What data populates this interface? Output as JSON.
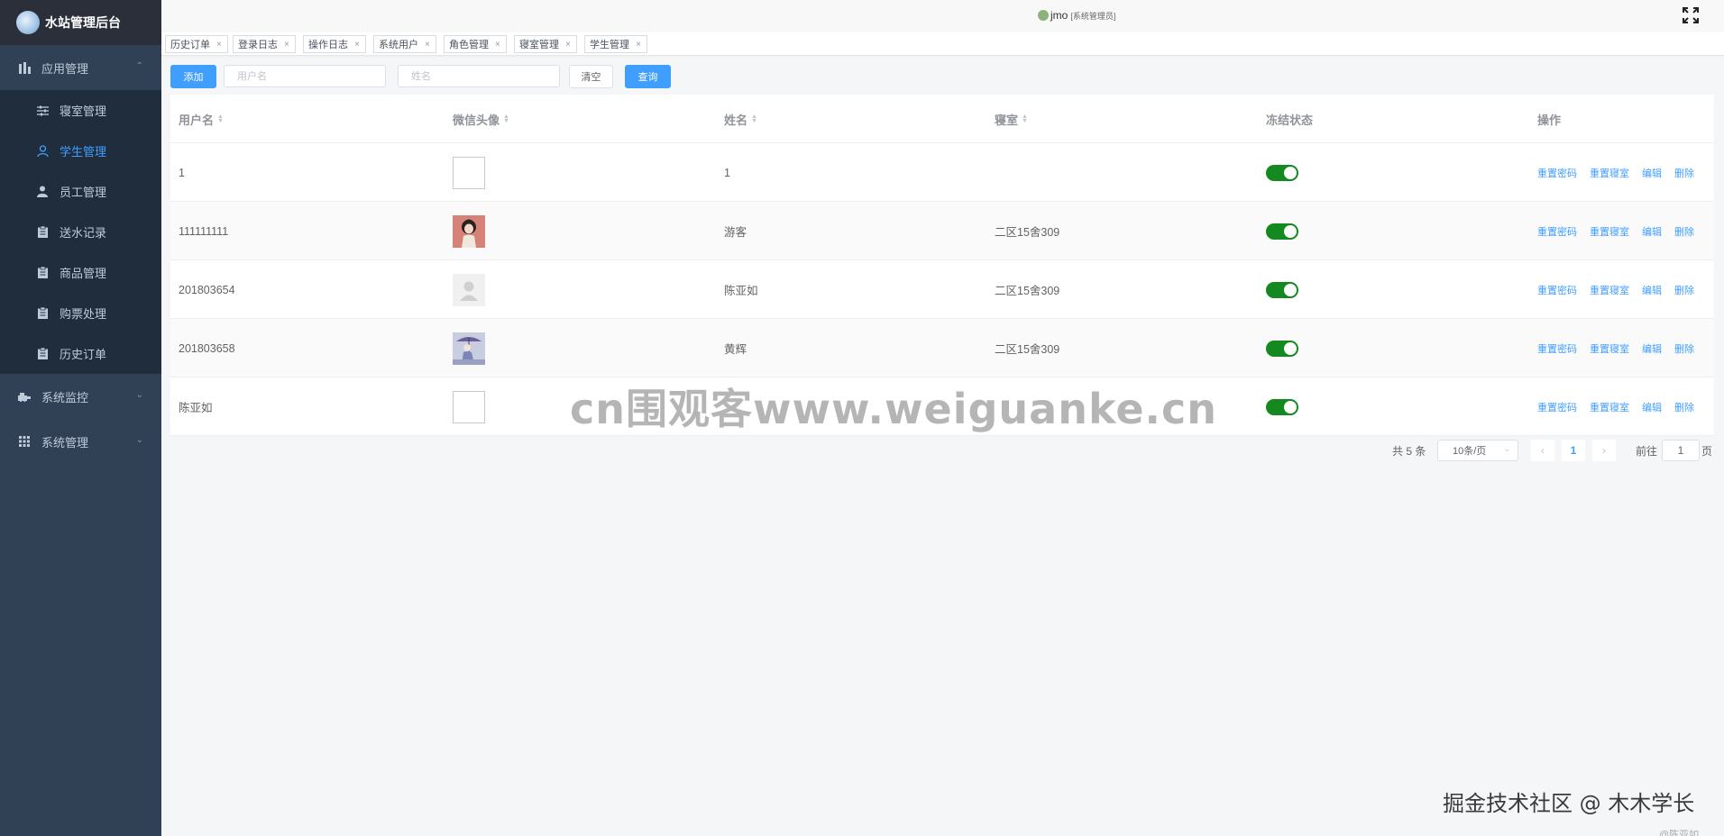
{
  "sidebar": {
    "title": "水站管理后台",
    "groups": [
      {
        "label": "应用管理",
        "expanded": true,
        "icon": "chart-icon"
      },
      {
        "label": "系统监控",
        "expanded": false,
        "icon": "monitor-icon"
      },
      {
        "label": "系统管理",
        "expanded": false,
        "icon": "grid-icon"
      }
    ],
    "items": [
      {
        "label": "寝室管理",
        "icon": "sliders-icon",
        "active": false
      },
      {
        "label": "学生管理",
        "icon": "user-icon",
        "active": true
      },
      {
        "label": "员工管理",
        "icon": "person-icon",
        "active": false
      },
      {
        "label": "送水记录",
        "icon": "clipboard-icon",
        "active": false
      },
      {
        "label": "商品管理",
        "icon": "clipboard-icon",
        "active": false
      },
      {
        "label": "购票处理",
        "icon": "clipboard-icon",
        "active": false
      },
      {
        "label": "历史订单",
        "icon": "clipboard-icon",
        "active": false
      }
    ]
  },
  "header": {
    "username": "jmo",
    "role": "[系统管理员]"
  },
  "tags": [
    "历史订单",
    "登录日志",
    "操作日志",
    "系统用户",
    "角色管理",
    "寝室管理",
    "学生管理"
  ],
  "toolbar": {
    "add_label": "添加",
    "username_placeholder": "用户名",
    "name_placeholder": "姓名",
    "clear_label": "清空",
    "search_label": "查询"
  },
  "table": {
    "columns": [
      "用户名",
      "微信头像",
      "姓名",
      "寝室",
      "冻结状态",
      "操作"
    ],
    "sortable": [
      true,
      true,
      true,
      true,
      false,
      false
    ],
    "rows": [
      {
        "username": "1",
        "avatar": "empty",
        "name": "1",
        "dorm": "",
        "frozen": true
      },
      {
        "username": "111111111",
        "avatar": "girl",
        "name": "游客",
        "dorm": "二区15舍309",
        "frozen": true
      },
      {
        "username": "201803654",
        "avatar": "default",
        "name": "陈亚如",
        "dorm": "二区15舍309",
        "frozen": true
      },
      {
        "username": "201803658",
        "avatar": "anime",
        "name": "黄辉",
        "dorm": "二区15舍309",
        "frozen": true
      },
      {
        "username": "陈亚如",
        "avatar": "empty",
        "name": "",
        "dorm": "",
        "frozen": true
      }
    ],
    "actions": [
      "重置密码",
      "重置寝室",
      "编辑",
      "删除"
    ]
  },
  "pagination": {
    "total_text": "共 5 条",
    "page_size": "10条/页",
    "current_page": "1",
    "goto_label": "前往",
    "goto_value": "1",
    "page_suffix": "页"
  },
  "watermarks": {
    "center": "cn围观客www.weiguanke.cn",
    "bottom": "掘金技术社区 @ 木木学长",
    "corner": "@陈亚如"
  }
}
